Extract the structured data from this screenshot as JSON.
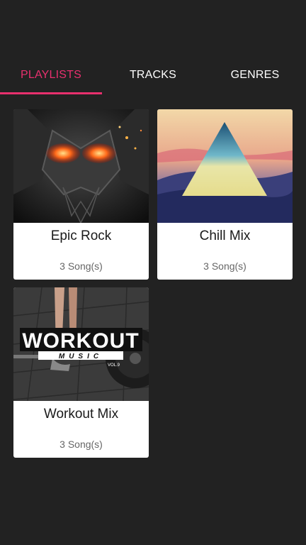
{
  "logo": {
    "icon": "equalizer-icon"
  },
  "tabs": [
    {
      "label": "PLAYLISTS",
      "active": true
    },
    {
      "label": "TRACKS",
      "active": false
    },
    {
      "label": "GENRES",
      "active": false
    }
  ],
  "colors": {
    "accent": "#e8306e",
    "background": "#222222",
    "card": "#ffffff"
  },
  "playlists": [
    {
      "title": "Epic Rock",
      "count": "3 Song(s)",
      "art": "robot-mask-art"
    },
    {
      "title": "Chill Mix",
      "count": "3 Song(s)",
      "art": "triangle-sunset-art"
    },
    {
      "title": "Workout Mix",
      "count": "3 Song(s)",
      "art": "workout-music-art",
      "art_text": {
        "main": "WORKOUT",
        "sub": "MUSIC",
        "vol": "VOL.9"
      }
    }
  ]
}
